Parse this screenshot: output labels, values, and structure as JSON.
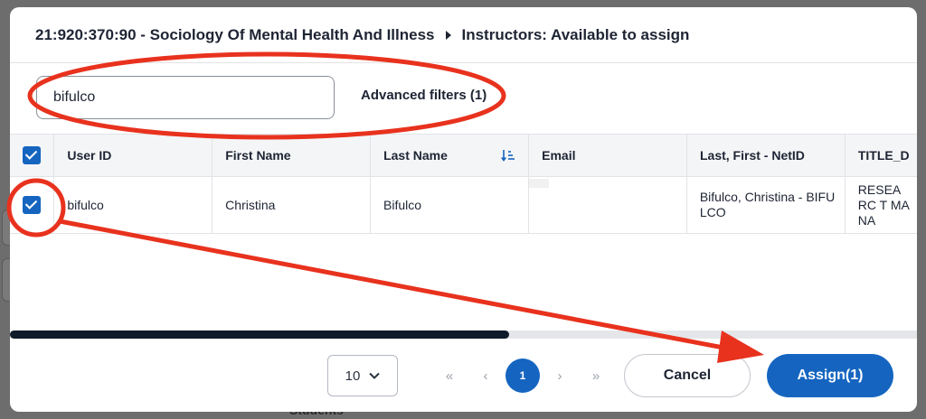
{
  "header": {
    "course": "21:920:370:90 - Sociology Of Mental Health And Illness",
    "section": "Instructors: Available to assign"
  },
  "filters": {
    "search_value": "bifulco",
    "advanced_label": "Advanced filters (1)"
  },
  "table": {
    "columns": [
      "User ID",
      "First Name",
      "Last Name",
      "Email",
      "Last, First - NetID",
      "TITLE_D"
    ],
    "rows": [
      {
        "user_id": "bifulco",
        "first_name": "Christina",
        "last_name": "Bifulco",
        "email": "",
        "netid_label": "Bifulco, Christina - BIFULCO",
        "title": "RESEARC T MANA"
      }
    ]
  },
  "footer": {
    "page_size": "10",
    "current_page": "1",
    "cancel_label": "Cancel",
    "assign_label": "Assign(1)"
  },
  "background": {
    "students_label": "Students"
  },
  "colors": {
    "primary": "#1565c0",
    "annotation": "#e8321e"
  }
}
